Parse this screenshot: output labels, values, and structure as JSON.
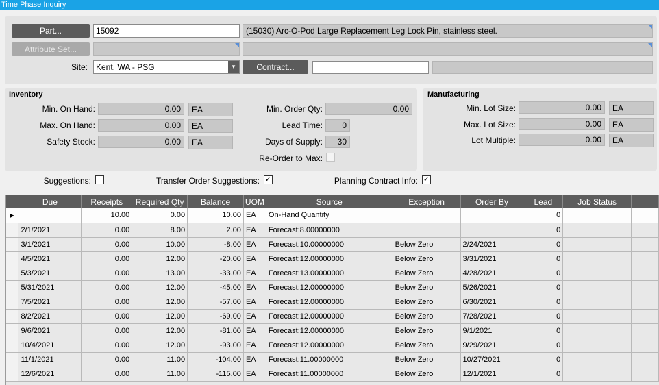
{
  "window": {
    "title": "Time Phase Inquiry"
  },
  "part": {
    "button_label": "Part...",
    "value": "15092",
    "description": "(15030) Arc-O-Pod Large Replacement Leg Lock Pin, stainless steel."
  },
  "attribute": {
    "button_label": "Attribute Set..."
  },
  "site": {
    "label": "Site:",
    "value": "Kent, WA - PSG"
  },
  "contract": {
    "button_label": "Contract...",
    "value": "",
    "description": ""
  },
  "inventory": {
    "title": "Inventory",
    "min_on_hand": {
      "label": "Min. On Hand:",
      "value": "0.00",
      "uom": "EA"
    },
    "max_on_hand": {
      "label": "Max. On Hand:",
      "value": "0.00",
      "uom": "EA"
    },
    "safety_stock": {
      "label": "Safety Stock:",
      "value": "0.00",
      "uom": "EA"
    },
    "min_order_qty": {
      "label": "Min. Order Qty:",
      "value": "0.00"
    },
    "lead_time": {
      "label": "Lead Time:",
      "value": "0"
    },
    "days_of_supply": {
      "label": "Days of Supply:",
      "value": "30"
    },
    "reorder_to_max": {
      "label": "Re-Order to Max:",
      "checked": false
    }
  },
  "manufacturing": {
    "title": "Manufacturing",
    "min_lot_size": {
      "label": "Min. Lot Size:",
      "value": "0.00",
      "uom": "EA"
    },
    "max_lot_size": {
      "label": "Max. Lot Size:",
      "value": "0.00",
      "uom": "EA"
    },
    "lot_multiple": {
      "label": "Lot Multiple:",
      "value": "0.00",
      "uom": "EA"
    }
  },
  "options": {
    "suggestions": {
      "label": "Suggestions:",
      "checked": false
    },
    "transfer_order": {
      "label": "Transfer Order Suggestions:",
      "checked": true
    },
    "planning_contract": {
      "label": "Planning Contract Info:",
      "checked": true
    }
  },
  "grid": {
    "columns": [
      "Due",
      "Receipts",
      "Required Qty",
      "Balance",
      "UOM",
      "Source",
      "Exception",
      "Order By",
      "Lead",
      "Job Status"
    ],
    "rows": [
      [
        "",
        "10.00",
        "0.00",
        "10.00",
        "EA",
        "On-Hand Quantity",
        "",
        "",
        "0",
        ""
      ],
      [
        "2/1/2021",
        "0.00",
        "8.00",
        "2.00",
        "EA",
        "Forecast:8.00000000",
        "",
        "",
        "0",
        ""
      ],
      [
        "3/1/2021",
        "0.00",
        "10.00",
        "-8.00",
        "EA",
        "Forecast:10.00000000",
        "Below Zero",
        "2/24/2021",
        "0",
        ""
      ],
      [
        "4/5/2021",
        "0.00",
        "12.00",
        "-20.00",
        "EA",
        "Forecast:12.00000000",
        "Below Zero",
        "3/31/2021",
        "0",
        ""
      ],
      [
        "5/3/2021",
        "0.00",
        "13.00",
        "-33.00",
        "EA",
        "Forecast:13.00000000",
        "Below Zero",
        "4/28/2021",
        "0",
        ""
      ],
      [
        "5/31/2021",
        "0.00",
        "12.00",
        "-45.00",
        "EA",
        "Forecast:12.00000000",
        "Below Zero",
        "5/26/2021",
        "0",
        ""
      ],
      [
        "7/5/2021",
        "0.00",
        "12.00",
        "-57.00",
        "EA",
        "Forecast:12.00000000",
        "Below Zero",
        "6/30/2021",
        "0",
        ""
      ],
      [
        "8/2/2021",
        "0.00",
        "12.00",
        "-69.00",
        "EA",
        "Forecast:12.00000000",
        "Below Zero",
        "7/28/2021",
        "0",
        ""
      ],
      [
        "9/6/2021",
        "0.00",
        "12.00",
        "-81.00",
        "EA",
        "Forecast:12.00000000",
        "Below Zero",
        "9/1/2021",
        "0",
        ""
      ],
      [
        "10/4/2021",
        "0.00",
        "12.00",
        "-93.00",
        "EA",
        "Forecast:12.00000000",
        "Below Zero",
        "9/29/2021",
        "0",
        ""
      ],
      [
        "11/1/2021",
        "0.00",
        "11.00",
        "-104.00",
        "EA",
        "Forecast:11.00000000",
        "Below Zero",
        "10/27/2021",
        "0",
        ""
      ],
      [
        "12/6/2021",
        "0.00",
        "11.00",
        "-115.00",
        "EA",
        "Forecast:11.00000000",
        "Below Zero",
        "12/1/2021",
        "0",
        ""
      ]
    ]
  }
}
